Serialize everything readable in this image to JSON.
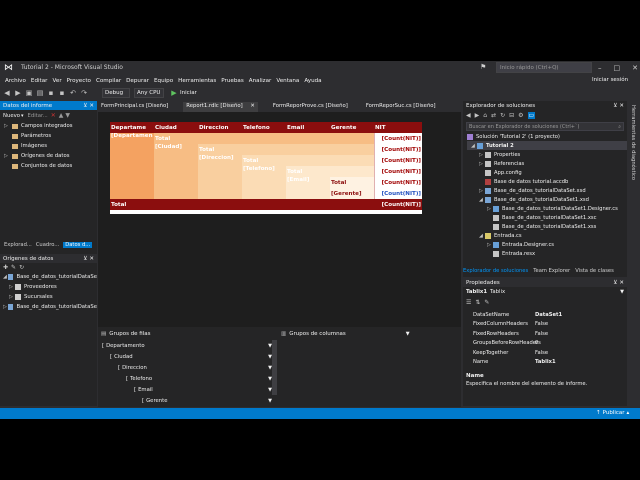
{
  "window": {
    "title": "Tutorial 2 - Microsoft Visual Studio",
    "quick_launch_placeholder": "Inicio rápido (Ctrl+Q)",
    "login": "Iniciar sesión"
  },
  "menu": [
    "Archivo",
    "Editar",
    "Ver",
    "Proyecto",
    "Compilar",
    "Depurar",
    "Equipo",
    "Herramientas",
    "Pruebas",
    "Analizar",
    "Ventana",
    "Ayuda"
  ],
  "toolbar": {
    "config": "Debug",
    "platform": "Any CPU",
    "start": "Iniciar"
  },
  "report_data": {
    "title": "Datos del informe",
    "new_label": "Nuevo",
    "edit_label": "Editar...",
    "items": [
      "Campos integrados",
      "Parámetros",
      "Imágenes",
      "Orígenes de datos",
      "Conjuntos de datos"
    ],
    "bottom_tabs": [
      "Explorad...",
      "Cuadro...",
      "Datos d..."
    ]
  },
  "data_sources": {
    "title": "Orígenes de datos",
    "items": [
      "Base_de_datos_tutorialDataSe",
      "Proveedores",
      "Sucursales",
      "Base_de_datos_tutorialDataSe"
    ]
  },
  "doc_tabs": [
    "FormPrincipal.cs [Diseño]",
    "Report1.rdlc [Diseño]",
    "FormReporProve.cs [Diseño]",
    "FormReporSuc.cs [Diseño]"
  ],
  "tablix": {
    "headers": [
      "Departame",
      "Ciudad",
      "Direccion",
      "Telefono",
      "Email",
      "Gerente",
      "NIT"
    ],
    "group_fields": [
      "[Departamen",
      "[Ciudad]",
      "[Direccion]",
      "[Telefono]",
      "[Email]",
      "[Gerente]"
    ],
    "total": "Total",
    "count": "[Count(NIT)]"
  },
  "grouping": {
    "rows_title": "Grupos de filas",
    "cols_title": "Grupos de columnas",
    "rows": [
      "Departamento",
      "Ciudad",
      "Direccion",
      "Telefono",
      "Email",
      "Gerente"
    ]
  },
  "solution": {
    "title": "Explorador de soluciones",
    "search_placeholder": "Buscar en Explorador de soluciones (Ctrl+`)",
    "items": [
      "Solución 'Tutorial 2' (1 proyecto)",
      "Tutorial 2",
      "Properties",
      "Referencias",
      "App.config",
      "Base de datos tutorial.accdb",
      "Base_de_datos_tutorialDataSet.xsd",
      "Base_de_datos_tutorialDataSet1.xsd",
      "Base_de_datos_tutorialDataSet1.Designer.cs",
      "Base_de_datos_tutorialDataSet1.xsc",
      "Base_de_datos_tutorialDataSet1.xss",
      "Entrada.cs",
      "Entrada.Designer.cs",
      "Entrada.resx"
    ],
    "tabs": [
      "Explorador de soluciones",
      "Team Explorer",
      "Vista de clases"
    ]
  },
  "properties": {
    "title": "Propiedades",
    "object": "Tablix1",
    "object_type": "Tablix",
    "rows": [
      {
        "name": "DataSetName",
        "value": "DataSet1"
      },
      {
        "name": "FixedColumnHeaders",
        "value": "False"
      },
      {
        "name": "FixedRowHeaders",
        "value": "False"
      },
      {
        "name": "GroupsBeforeRowHeaders",
        "value": "0"
      },
      {
        "name": "KeepTogether",
        "value": "False"
      },
      {
        "name": "Name",
        "value": "Tablix1"
      }
    ],
    "desc_title": "Name",
    "desc_text": "Especifica el nombre del elemento de informe."
  },
  "side_label": "Herramientas de diagnóstico",
  "status": {
    "publish": "Publicar"
  },
  "colors": {
    "accent": "#007acc",
    "header": "#8b0e0e",
    "background": "#2d2d30"
  }
}
